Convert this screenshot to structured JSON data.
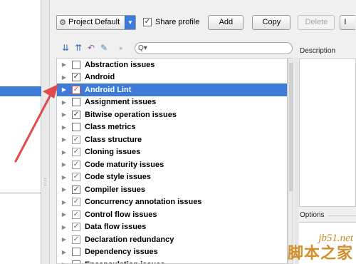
{
  "toolbar": {
    "profile_value": "Project Default",
    "profile_icon": "gear-icon",
    "share_label": "Share profile",
    "share_checked": true,
    "add_label": "Add",
    "copy_label": "Copy",
    "delete_label": "Delete",
    "import_partial": "I"
  },
  "filter": {
    "expand_icon": "expand-all-icon",
    "collapse_icon": "collapse-all-icon",
    "reset_icon": "reset-icon",
    "clean_icon": "clean-icon",
    "more_glyph": "»",
    "search_glyph": "Q▾"
  },
  "inspections": [
    {
      "label": "Abstraction issues",
      "checked": false,
      "partial": false
    },
    {
      "label": "Android",
      "checked": true,
      "partial": false
    },
    {
      "label": "Android Lint",
      "checked": true,
      "partial": false,
      "selected": true
    },
    {
      "label": "Assignment issues",
      "checked": false,
      "partial": false
    },
    {
      "label": "Bitwise operation issues",
      "checked": true,
      "partial": false
    },
    {
      "label": "Class metrics",
      "checked": false,
      "partial": false
    },
    {
      "label": "Class structure",
      "checked": true,
      "partial": true
    },
    {
      "label": "Cloning issues",
      "checked": true,
      "partial": true
    },
    {
      "label": "Code maturity issues",
      "checked": true,
      "partial": true
    },
    {
      "label": "Code style issues",
      "checked": true,
      "partial": true
    },
    {
      "label": "Compiler issues",
      "checked": true,
      "partial": false
    },
    {
      "label": "Concurrency annotation issues",
      "checked": true,
      "partial": true
    },
    {
      "label": "Control flow issues",
      "checked": true,
      "partial": true
    },
    {
      "label": "Data flow issues",
      "checked": true,
      "partial": true
    },
    {
      "label": "Declaration redundancy",
      "checked": true,
      "partial": true
    },
    {
      "label": "Dependency issues",
      "checked": false,
      "partial": false
    },
    {
      "label": "Encapsulation issues",
      "checked": false,
      "partial": false
    }
  ],
  "right": {
    "description_label": "Description",
    "options_label": "Options"
  },
  "watermark": {
    "line1": "jb51.net",
    "line2": "脚本之家"
  },
  "colors": {
    "selection": "#3d7bd8",
    "annotation": "#e24b4b"
  }
}
